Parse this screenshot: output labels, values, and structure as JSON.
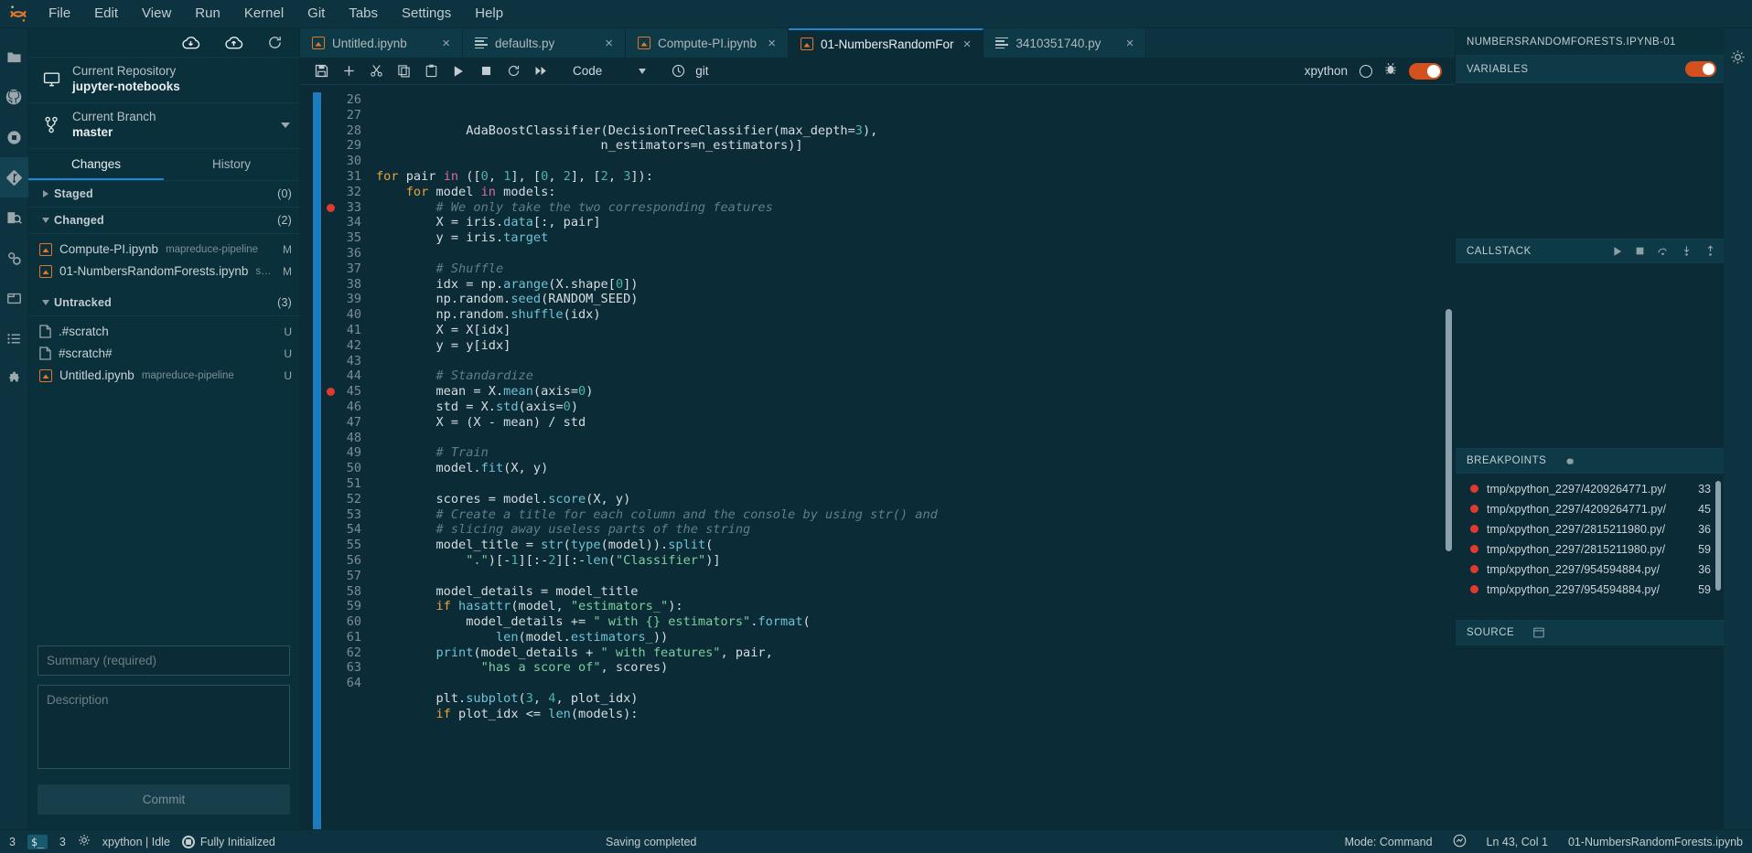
{
  "menubar": {
    "logo": "jupyter-logo",
    "items": [
      "File",
      "Edit",
      "View",
      "Run",
      "Kernel",
      "Git",
      "Tabs",
      "Settings",
      "Help"
    ]
  },
  "rail": {
    "items": [
      {
        "name": "file-browser",
        "icon": "folder-icon",
        "active": false
      },
      {
        "name": "github",
        "icon": "github-icon",
        "active": false
      },
      {
        "name": "running-terminals",
        "icon": "stop-circle-icon",
        "active": false
      },
      {
        "name": "git",
        "icon": "git-diamond-icon",
        "active": true
      },
      {
        "name": "debugger",
        "icon": "debug-inspect-icon",
        "active": false
      },
      {
        "name": "property-inspector",
        "icon": "gears-icon",
        "active": false
      },
      {
        "name": "open-tabs",
        "icon": "window-icon",
        "active": false
      },
      {
        "name": "table-of-contents",
        "icon": "list-icon",
        "active": false
      },
      {
        "name": "extension-manager",
        "icon": "puzzle-icon",
        "active": false
      }
    ]
  },
  "git": {
    "toolbar": [
      {
        "name": "pull-button",
        "icon": "cloud-download-icon"
      },
      {
        "name": "push-button",
        "icon": "cloud-upload-icon"
      },
      {
        "name": "refresh-button",
        "icon": "refresh-icon"
      }
    ],
    "repository": {
      "label": "Current Repository",
      "value": "jupyter-notebooks"
    },
    "branch": {
      "label": "Current Branch",
      "value": "master"
    },
    "tabs": [
      {
        "label": "Changes",
        "selected": true
      },
      {
        "label": "History",
        "selected": false
      }
    ],
    "sections": [
      {
        "title": "Staged",
        "count": "(0)",
        "expanded": false,
        "files": []
      },
      {
        "title": "Changed",
        "count": "(2)",
        "expanded": true,
        "files": [
          {
            "name": "Compute-PI.ipynb",
            "dir": "mapreduce-pipeline",
            "status": "M",
            "icon": "notebook-icon"
          },
          {
            "name": "01-NumbersRandomForests.ipynb",
            "dir": "scikitlearn",
            "status": "M",
            "icon": "notebook-icon"
          }
        ]
      },
      {
        "title": "Untracked",
        "count": "(3)",
        "expanded": true,
        "files": [
          {
            "name": ".#scratch",
            "dir": "",
            "status": "U",
            "icon": "file-icon"
          },
          {
            "name": "#scratch#",
            "dir": "",
            "status": "U",
            "icon": "file-icon"
          },
          {
            "name": "Untitled.ipynb",
            "dir": "mapreduce-pipeline",
            "status": "U",
            "icon": "notebook-icon"
          }
        ]
      }
    ],
    "commit": {
      "summary_value": "",
      "summary_placeholder": "Summary (required)",
      "description_value": "",
      "description_placeholder": "Description",
      "button_label": "Commit"
    }
  },
  "tabs": [
    {
      "label": "Untitled.ipynb",
      "icon": "notebook-icon",
      "active": false,
      "close": "×"
    },
    {
      "label": "defaults.py",
      "icon": "python-icon",
      "active": false,
      "close": "×"
    },
    {
      "label": "Compute-PI.ipynb",
      "icon": "notebook-icon",
      "active": false,
      "close": "×"
    },
    {
      "label": "01-NumbersRandomFor",
      "icon": "notebook-icon",
      "active": true,
      "close": "×"
    },
    {
      "label": "3410351740.py",
      "icon": "python-icon",
      "active": false,
      "close": "×"
    }
  ],
  "notebook_toolbar": {
    "buttons": [
      {
        "name": "save-button",
        "icon": "save-icon"
      },
      {
        "name": "insert-cell-button",
        "icon": "plus-icon"
      },
      {
        "name": "cut-button",
        "icon": "scissors-icon"
      },
      {
        "name": "copy-button",
        "icon": "copy-icon"
      },
      {
        "name": "paste-button",
        "icon": "paste-icon"
      },
      {
        "name": "run-button",
        "icon": "play-icon"
      },
      {
        "name": "stop-button",
        "icon": "square-icon"
      },
      {
        "name": "restart-button",
        "icon": "restart-icon"
      },
      {
        "name": "restart-run-all-button",
        "icon": "fast-forward-icon"
      }
    ],
    "cell_type": "Code",
    "branch_indicator": "git",
    "kernel_name": "xpython",
    "kernel_status_icon": "kernel-idle-circle",
    "debug_icon": "bug-icon",
    "debug_enabled": true
  },
  "code_cell": {
    "first_line_number": 26,
    "breakpoint_lines": [
      33,
      45
    ],
    "lines": [
      {
        "n": 26,
        "html": "            <span class='pl'>AdaBoostClassifier(DecisionTreeClassifier(max_depth=</span><span class='num'>3</span><span class='pl'>),</span>"
      },
      {
        "n": 27,
        "html": "                              <span class='pl'>n_estimators=n_estimators)]</span>"
      },
      {
        "n": 28,
        "html": ""
      },
      {
        "n": 29,
        "html": "<span class='kw'>for</span> <span class='pl'>pair</span> <span class='kw2'>in</span> <span class='pl'>([</span><span class='num'>0</span><span class='pl'>, </span><span class='num'>1</span><span class='pl'>], [</span><span class='num'>0</span><span class='pl'>, </span><span class='num'>2</span><span class='pl'>], [</span><span class='num'>2</span><span class='pl'>, </span><span class='num'>3</span><span class='pl'>]):</span>"
      },
      {
        "n": 30,
        "html": "    <span class='kw'>for</span> <span class='pl'>model</span> <span class='kw2'>in</span> <span class='pl'>models:</span>"
      },
      {
        "n": 31,
        "html": "        <span class='cmt'># We only take the two corresponding features</span>"
      },
      {
        "n": 32,
        "html": "        <span class='pl'>X = iris.</span><span class='fn'>data</span><span class='pl'>[:, pair]</span>"
      },
      {
        "n": 33,
        "html": "        <span class='pl'>y = iris.</span><span class='fn'>target</span>"
      },
      {
        "n": 34,
        "html": ""
      },
      {
        "n": 35,
        "html": "        <span class='cmt'># Shuffle</span>"
      },
      {
        "n": 36,
        "html": "        <span class='pl'>idx = np.</span><span class='fn'>arange</span><span class='pl'>(X.shape[</span><span class='num'>0</span><span class='pl'>])</span>"
      },
      {
        "n": 37,
        "html": "        <span class='pl'>np.random.</span><span class='fn'>seed</span><span class='pl'>(RANDOM_SEED)</span>"
      },
      {
        "n": 38,
        "html": "        <span class='pl'>np.random.</span><span class='fn'>shuffle</span><span class='pl'>(idx)</span>"
      },
      {
        "n": 39,
        "html": "        <span class='pl'>X = X[idx]</span>"
      },
      {
        "n": 40,
        "html": "        <span class='pl'>y = y[idx]</span>"
      },
      {
        "n": 41,
        "html": ""
      },
      {
        "n": 42,
        "html": "        <span class='cmt'># Standardize</span>"
      },
      {
        "n": 43,
        "html": "        <span class='pl'>mean = X.</span><span class='fn'>mean</span><span class='pl'>(axis=</span><span class='num'>0</span><span class='pl'>)</span>"
      },
      {
        "n": 44,
        "html": "        <span class='pl'>std = X.</span><span class='fn'>std</span><span class='pl'>(axis=</span><span class='num'>0</span><span class='pl'>)</span>"
      },
      {
        "n": 45,
        "html": "        <span class='pl'>X = (X - mean) / std</span>"
      },
      {
        "n": 46,
        "html": ""
      },
      {
        "n": 47,
        "html": "        <span class='cmt'># Train</span>"
      },
      {
        "n": 48,
        "html": "        <span class='pl'>model.</span><span class='fn'>fit</span><span class='pl'>(X, y)</span>"
      },
      {
        "n": 49,
        "html": ""
      },
      {
        "n": 50,
        "html": "        <span class='pl'>scores = model.</span><span class='fn'>score</span><span class='pl'>(X, y)</span>"
      },
      {
        "n": 51,
        "html": "        <span class='cmt'># Create a title for each column and the console by using str() and</span>"
      },
      {
        "n": 52,
        "html": "        <span class='cmt'># slicing away useless parts of the string</span>"
      },
      {
        "n": 53,
        "html": "        <span class='pl'>model_title = </span><span class='fn'>str</span><span class='pl'>(</span><span class='fn'>type</span><span class='pl'>(model)).</span><span class='fn'>split</span><span class='pl'>(</span>"
      },
      {
        "n": 54,
        "html": "            <span class='str'>\".\"</span><span class='pl'>)[-</span><span class='num'>1</span><span class='pl'>][:-</span><span class='num'>2</span><span class='pl'>][:-</span><span class='fn'>len</span><span class='pl'>(</span><span class='str'>\"Classifier\"</span><span class='pl'>)]</span>"
      },
      {
        "n": 55,
        "html": ""
      },
      {
        "n": 56,
        "html": "        <span class='pl'>model_details = model_title</span>"
      },
      {
        "n": 57,
        "html": "        <span class='kw'>if</span> <span class='fn'>hasattr</span><span class='pl'>(model, </span><span class='str'>\"estimators_\"</span><span class='pl'>):</span>"
      },
      {
        "n": 58,
        "html": "            <span class='pl'>model_details += </span><span class='str'>\" with {} estimators\"</span><span class='pl'>.</span><span class='fn'>format</span><span class='pl'>(</span>"
      },
      {
        "n": 59,
        "html": "                <span class='fn'>len</span><span class='pl'>(model.</span><span class='fn'>estimators_</span><span class='pl'>))</span>"
      },
      {
        "n": 60,
        "html": "        <span class='fn'>print</span><span class='pl'>(model_details + </span><span class='str'>\" with features\"</span><span class='pl'>, pair,</span>"
      },
      {
        "n": 61,
        "html": "              <span class='str'>\"has a score of\"</span><span class='pl'>, scores)</span>"
      },
      {
        "n": 62,
        "html": ""
      },
      {
        "n": 63,
        "html": "        <span class='pl'>plt.</span><span class='fn'>subplot</span><span class='pl'>(</span><span class='num'>3</span><span class='pl'>, </span><span class='num'>4</span><span class='pl'>, plot_idx)</span>"
      },
      {
        "n": 64,
        "html": "        <span class='kw'>if</span> <span class='pl'>plot_idx &lt;= </span><span class='fn'>len</span><span class='pl'>(models):</span>"
      }
    ]
  },
  "debugger": {
    "title": "NUMBERSRANDOMFORESTS.IPYNB-01",
    "variables": {
      "title": "VARIABLES",
      "toggle_on": true
    },
    "callstack": {
      "title": "CALLSTACK",
      "buttons": [
        {
          "name": "continue-button",
          "icon": "play-icon"
        },
        {
          "name": "terminate-button",
          "icon": "square-icon"
        },
        {
          "name": "step-over-button",
          "icon": "step-over-icon"
        },
        {
          "name": "step-in-button",
          "icon": "step-in-icon"
        },
        {
          "name": "step-out-button",
          "icon": "step-out-icon"
        }
      ]
    },
    "breakpoints": {
      "title": "BREAKPOINTS",
      "action_icon": "remove-all-breakpoints-icon",
      "items": [
        {
          "path": "tmp/xpython_2297/4209264771.py/",
          "line": "33"
        },
        {
          "path": "tmp/xpython_2297/4209264771.py/",
          "line": "45"
        },
        {
          "path": "tmp/xpython_2297/2815211980.py/",
          "line": "36"
        },
        {
          "path": "tmp/xpython_2297/2815211980.py/",
          "line": "59"
        },
        {
          "path": "tmp/xpython_2297/954594884.py/",
          "line": "36"
        },
        {
          "path": "tmp/xpython_2297/954594884.py/",
          "line": "59"
        }
      ]
    },
    "source": {
      "title": "SOURCE",
      "action_icon": "open-source-icon"
    }
  },
  "statusbar": {
    "left_count_1": "3",
    "terminal_chip": "$_",
    "left_count_2": "3",
    "settings_icon": "gear-icon",
    "kernel_text": "xpython | Idle",
    "init_icon": "kernel-busy-icon",
    "init_text": "Fully Initialized",
    "center_text": "Saving completed",
    "mode_text": "Mode: Command",
    "nb_icon": "notebook-status-icon",
    "position_text": "Ln 43, Col 1",
    "file_text": "01-NumbersRandomForests.ipynb"
  }
}
